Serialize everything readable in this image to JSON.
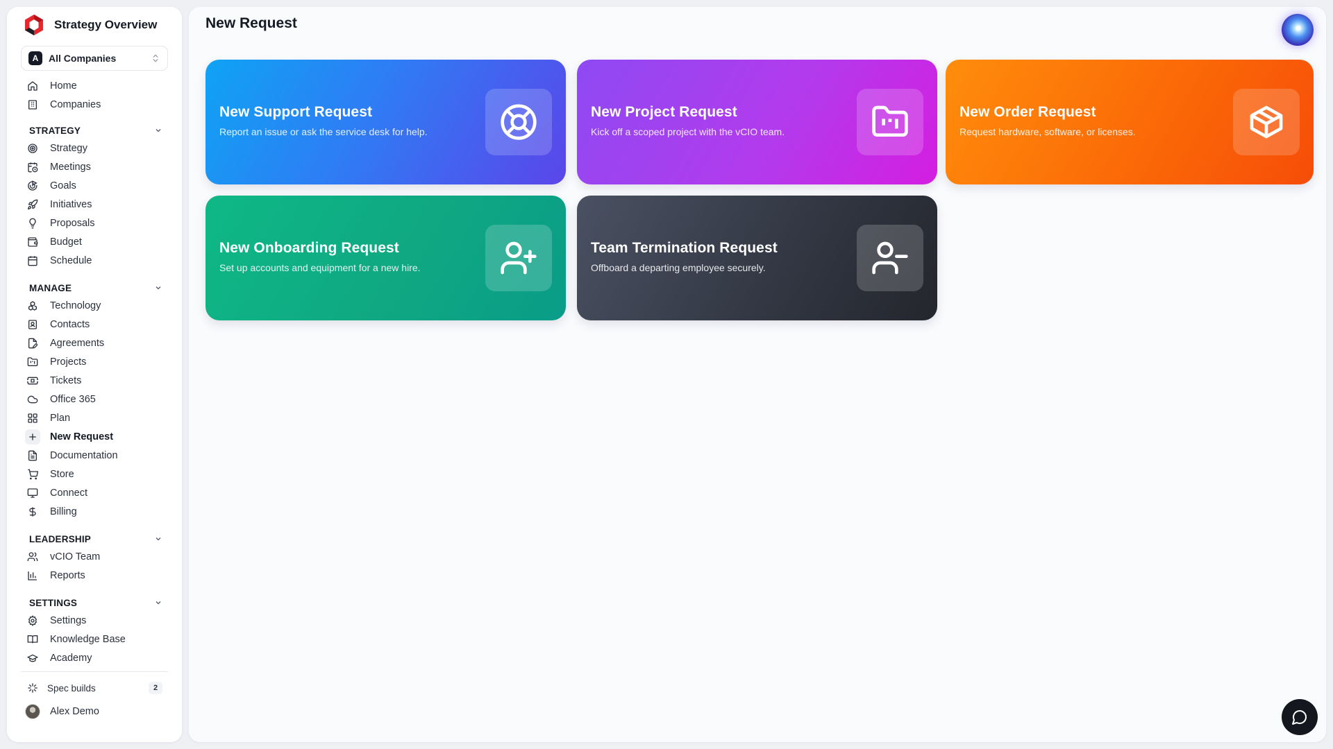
{
  "app": {
    "title": "Strategy Overview"
  },
  "company_select": {
    "badge": "A",
    "label": "All Companies"
  },
  "nav_top": [
    {
      "label": "Home",
      "icon": "home-icon"
    },
    {
      "label": "Companies",
      "icon": "building-icon"
    }
  ],
  "sections": {
    "strategy": {
      "title": "STRATEGY",
      "items": [
        {
          "label": "Strategy",
          "icon": "target-icon"
        },
        {
          "label": "Meetings",
          "icon": "calendar-clock-icon"
        },
        {
          "label": "Goals",
          "icon": "goal-icon"
        },
        {
          "label": "Initiatives",
          "icon": "rocket-icon"
        },
        {
          "label": "Proposals",
          "icon": "lightbulb-icon"
        },
        {
          "label": "Budget",
          "icon": "wallet-icon"
        },
        {
          "label": "Schedule",
          "icon": "calendar-icon"
        }
      ]
    },
    "manage": {
      "title": "MANAGE",
      "items": [
        {
          "label": "Technology",
          "icon": "boxes-icon"
        },
        {
          "label": "Contacts",
          "icon": "contact-icon"
        },
        {
          "label": "Agreements",
          "icon": "file-pen-icon"
        },
        {
          "label": "Projects",
          "icon": "folder-kanban-icon"
        },
        {
          "label": "Tickets",
          "icon": "ticket-icon"
        },
        {
          "label": "Office 365",
          "icon": "cloud-icon"
        },
        {
          "label": "Plan",
          "icon": "grid-icon"
        },
        {
          "label": "New Request",
          "icon": "plus-icon",
          "active": true
        },
        {
          "label": "Documentation",
          "icon": "document-icon"
        },
        {
          "label": "Store",
          "icon": "cart-icon"
        },
        {
          "label": "Connect",
          "icon": "monitor-icon"
        },
        {
          "label": "Billing",
          "icon": "dollar-icon"
        }
      ]
    },
    "leadership": {
      "title": "LEADERSHIP",
      "items": [
        {
          "label": "vCIO Team",
          "icon": "users-icon"
        },
        {
          "label": "Reports",
          "icon": "bar-chart-icon"
        }
      ]
    },
    "settings": {
      "title": "SETTINGS",
      "items": [
        {
          "label": "Settings",
          "icon": "gear-icon"
        },
        {
          "label": "Knowledge Base",
          "icon": "book-icon"
        },
        {
          "label": "Academy",
          "icon": "graduation-cap-icon"
        }
      ]
    }
  },
  "footer": {
    "spec_label": "Spec builds",
    "spec_count": "2",
    "user_name": "Alex Demo"
  },
  "main": {
    "title": "New Request",
    "cards": [
      {
        "title": "New Support Request",
        "desc": "Report an issue or ask the service desk for help.",
        "icon": "life-buoy-icon",
        "color": "#2f7cf4"
      },
      {
        "title": "New Project Request",
        "desc": "Kick off a scoped project with the vCIO team.",
        "icon": "folder-kanban-icon",
        "color": "#b23bed"
      },
      {
        "title": "New Order Request",
        "desc": "Request hardware, software, or licenses.",
        "icon": "package-icon",
        "color": "#fb6a07"
      },
      {
        "title": "New Onboarding Request",
        "desc": "Set up accounts and equipment for a new hire.",
        "icon": "user-plus-icon",
        "color": "#0fa882"
      },
      {
        "title": "Team Termination Request",
        "desc": "Offboard a departing employee securely.",
        "icon": "user-minus-icon",
        "color": "#333844"
      }
    ]
  }
}
